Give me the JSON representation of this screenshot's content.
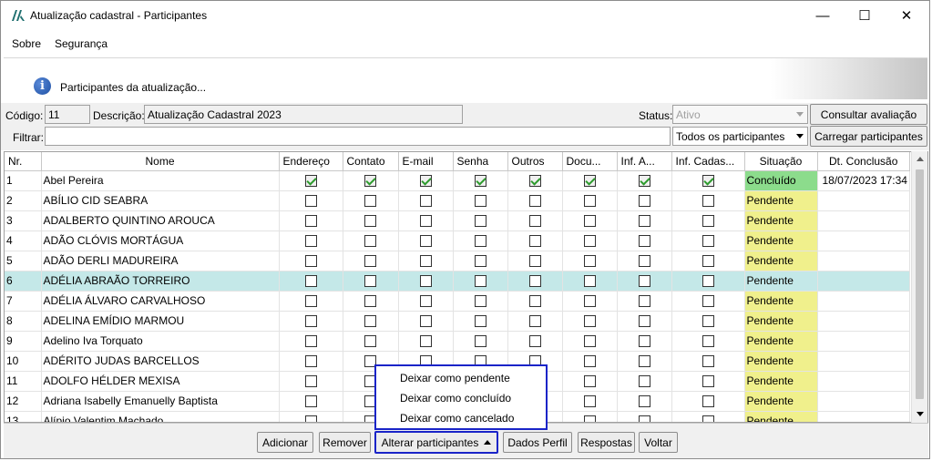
{
  "window": {
    "title": "Atualização cadastral - Participantes",
    "minimize": "—",
    "maximize": "☐",
    "close": "✕"
  },
  "menu": {
    "items": [
      "Sobre",
      "Segurança"
    ]
  },
  "banner": {
    "text": "Participantes da atualização..."
  },
  "form": {
    "codigo_label": "Código:",
    "codigo_value": "11",
    "descricao_label": "Descrição:",
    "descricao_value": "Atualização Cadastral 2023",
    "status_label": "Status:",
    "status_value": "Ativo",
    "consultar_button": "Consultar avaliação",
    "filtrar_label": "Filtrar:",
    "filtrar_value": "",
    "filter_select": "Todos os participantes",
    "carregar_button": "Carregar participantes"
  },
  "grid": {
    "headers": [
      "Nr.",
      "Nome",
      "Endereço",
      "Contato",
      "E-mail",
      "Senha",
      "Outros",
      "Docu...",
      "Inf. A...",
      "Inf. Cadas...",
      "Situação",
      "Dt. Conclusão"
    ],
    "rows": [
      {
        "nr": "1",
        "nome": "Abel Pereira",
        "checks": [
          true,
          true,
          true,
          true,
          true,
          true,
          true,
          true
        ],
        "situacao": "Concluído",
        "dt": "18/07/2023 17:34"
      },
      {
        "nr": "2",
        "nome": "ABÍLIO CID SEABRA",
        "checks": [
          false,
          false,
          false,
          false,
          false,
          false,
          false,
          false
        ],
        "situacao": "Pendente",
        "dt": ""
      },
      {
        "nr": "3",
        "nome": "ADALBERTO QUINTINO AROUCA",
        "checks": [
          false,
          false,
          false,
          false,
          false,
          false,
          false,
          false
        ],
        "situacao": "Pendente",
        "dt": ""
      },
      {
        "nr": "4",
        "nome": "ADÃO CLÓVIS MORTÁGUA",
        "checks": [
          false,
          false,
          false,
          false,
          false,
          false,
          false,
          false
        ],
        "situacao": "Pendente",
        "dt": ""
      },
      {
        "nr": "5",
        "nome": "ADÃO DERLI MADUREIRA",
        "checks": [
          false,
          false,
          false,
          false,
          false,
          false,
          false,
          false
        ],
        "situacao": "Pendente",
        "dt": ""
      },
      {
        "nr": "6",
        "nome": "ADÉLIA ABRAÃO TORREIRO",
        "checks": [
          false,
          false,
          false,
          false,
          false,
          false,
          false,
          false
        ],
        "situacao": "Pendente",
        "dt": "",
        "selected": true
      },
      {
        "nr": "7",
        "nome": "ADÉLIA ÁLVARO CARVALHOSO",
        "checks": [
          false,
          false,
          false,
          false,
          false,
          false,
          false,
          false
        ],
        "situacao": "Pendente",
        "dt": ""
      },
      {
        "nr": "8",
        "nome": "ADELINA EMÍDIO MARMOU",
        "checks": [
          false,
          false,
          false,
          false,
          false,
          false,
          false,
          false
        ],
        "situacao": "Pendente",
        "dt": ""
      },
      {
        "nr": "9",
        "nome": "Adelino Iva Torquato",
        "checks": [
          false,
          false,
          false,
          false,
          false,
          false,
          false,
          false
        ],
        "situacao": "Pendente",
        "dt": ""
      },
      {
        "nr": "10",
        "nome": "ADÉRITO JUDAS BARCELLOS",
        "checks": [
          false,
          false,
          false,
          false,
          false,
          false,
          false,
          false
        ],
        "situacao": "Pendente",
        "dt": ""
      },
      {
        "nr": "11",
        "nome": "ADOLFO HÉLDER MEXISA",
        "checks": [
          false,
          false,
          false,
          false,
          false,
          false,
          false,
          false
        ],
        "situacao": "Pendente",
        "dt": ""
      },
      {
        "nr": "12",
        "nome": "Adriana Isabelly Emanuelly Baptista",
        "checks": [
          false,
          false,
          false,
          false,
          false,
          false,
          false,
          false
        ],
        "situacao": "Pendente",
        "dt": ""
      },
      {
        "nr": "13",
        "nome": "Alípio Valentim Machado",
        "checks": [
          false,
          false,
          false,
          false,
          false,
          false,
          false,
          false
        ],
        "situacao": "Pendente",
        "dt": ""
      }
    ]
  },
  "buttons": {
    "adicionar": "Adicionar",
    "remover": "Remover",
    "alterar": "Alterar participantes",
    "dados": "Dados Perfil",
    "respostas": "Respostas",
    "voltar": "Voltar"
  },
  "popup": {
    "items": [
      "Deixar como pendente",
      "Deixar como concluído",
      "Deixar como cancelado"
    ]
  },
  "colors": {
    "selected_row": "#c4e8e8",
    "pending": "#f0f08c",
    "done": "#8cdc8c",
    "highlight": "#1a24c8"
  }
}
